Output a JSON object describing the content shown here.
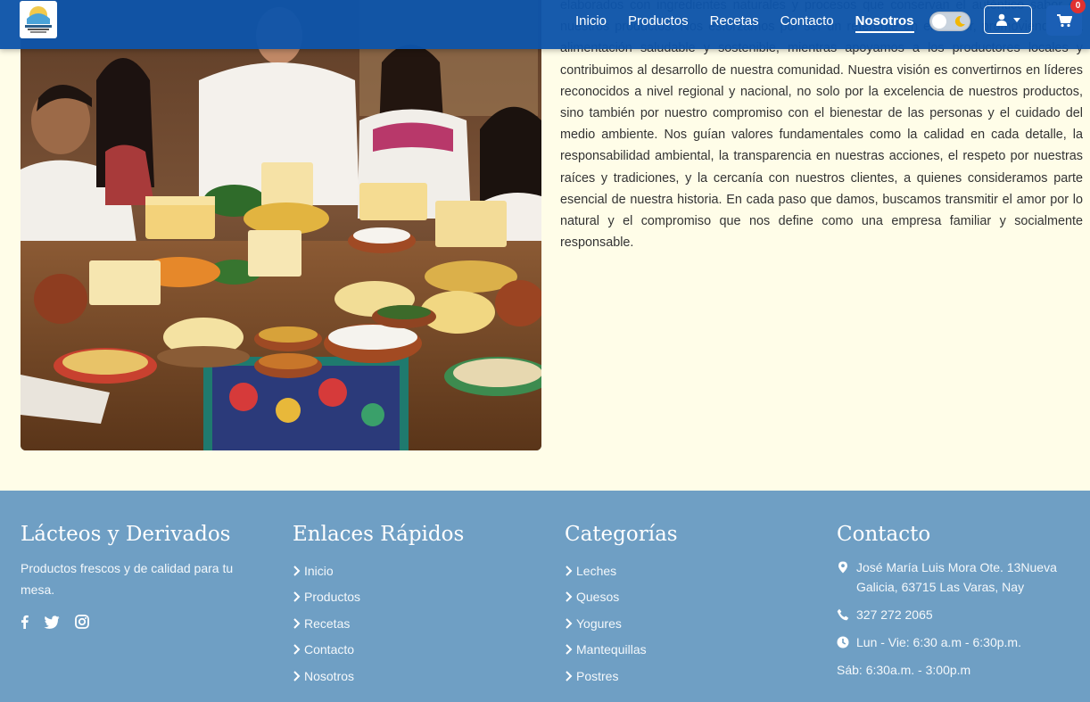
{
  "nav": {
    "brand_alt": "Lácteos y Derivados",
    "links": [
      "Inicio",
      "Productos",
      "Recetas",
      "Contacto",
      "Nosotros"
    ],
    "active": "Nosotros",
    "cart_count": "0"
  },
  "about": {
    "paragraph": "elaborados con ingredientes naturales y procesos que conservan el auténtico sabor de nuestros productos. Nos esforzamos por ser un referente en el sector, promoviendo una alimentación saludable y sostenible, mientras apoyamos a los productores locales y contribuimos al desarrollo de nuestra comunidad. Nuestra visión es convertirnos en líderes reconocidos a nivel regional y nacional, no solo por la excelencia de nuestros productos, sino también por nuestro compromiso con el bienestar de las personas y el cuidado del medio ambiente. Nos guían valores fundamentales como la calidad en cada detalle, la responsabilidad ambiental, la transparencia en nuestras acciones, el respeto por nuestras raíces y tradiciones, y la cercanía con nuestros clientes, a quienes consideramos parte esencial de nuestra historia. En cada paso que damos, buscamos transmitir el amor por lo natural y el compromiso que nos define como una empresa familiar y socialmente responsable."
  },
  "footer": {
    "brand": {
      "title": "Lácteos y Derivados",
      "tagline": "Productos frescos y de calidad para tu mesa."
    },
    "quick_links": {
      "title": "Enlaces Rápidos",
      "items": [
        "Inicio",
        "Productos",
        "Recetas",
        "Contacto",
        "Nosotros"
      ]
    },
    "categories": {
      "title": "Categorías",
      "items": [
        "Leches",
        "Quesos",
        "Yogures",
        "Mantequillas",
        "Postres"
      ]
    },
    "contact": {
      "title": "Contacto",
      "address": "José María Luis Mora Ote. 13Nueva Galicia, 63715 Las Varas, Nay",
      "phone": "327 272 2065",
      "hours_weekday": "Lun - Vie: 6:30 a.m - 6:30p.m.",
      "hours_saturday": "Sáb: 6:30a.m. - 3:00p.m"
    }
  },
  "colors": {
    "navbar": "#0e54aa",
    "footer": "#6f9fc4",
    "page_bg": "#fffde8",
    "badge": "#e03131"
  },
  "icons": [
    "facebook-icon",
    "twitter-icon",
    "instagram-icon",
    "user-icon",
    "cart-icon",
    "moon-icon",
    "map-pin-icon",
    "phone-icon",
    "clock-icon",
    "chevron-right-icon"
  ]
}
